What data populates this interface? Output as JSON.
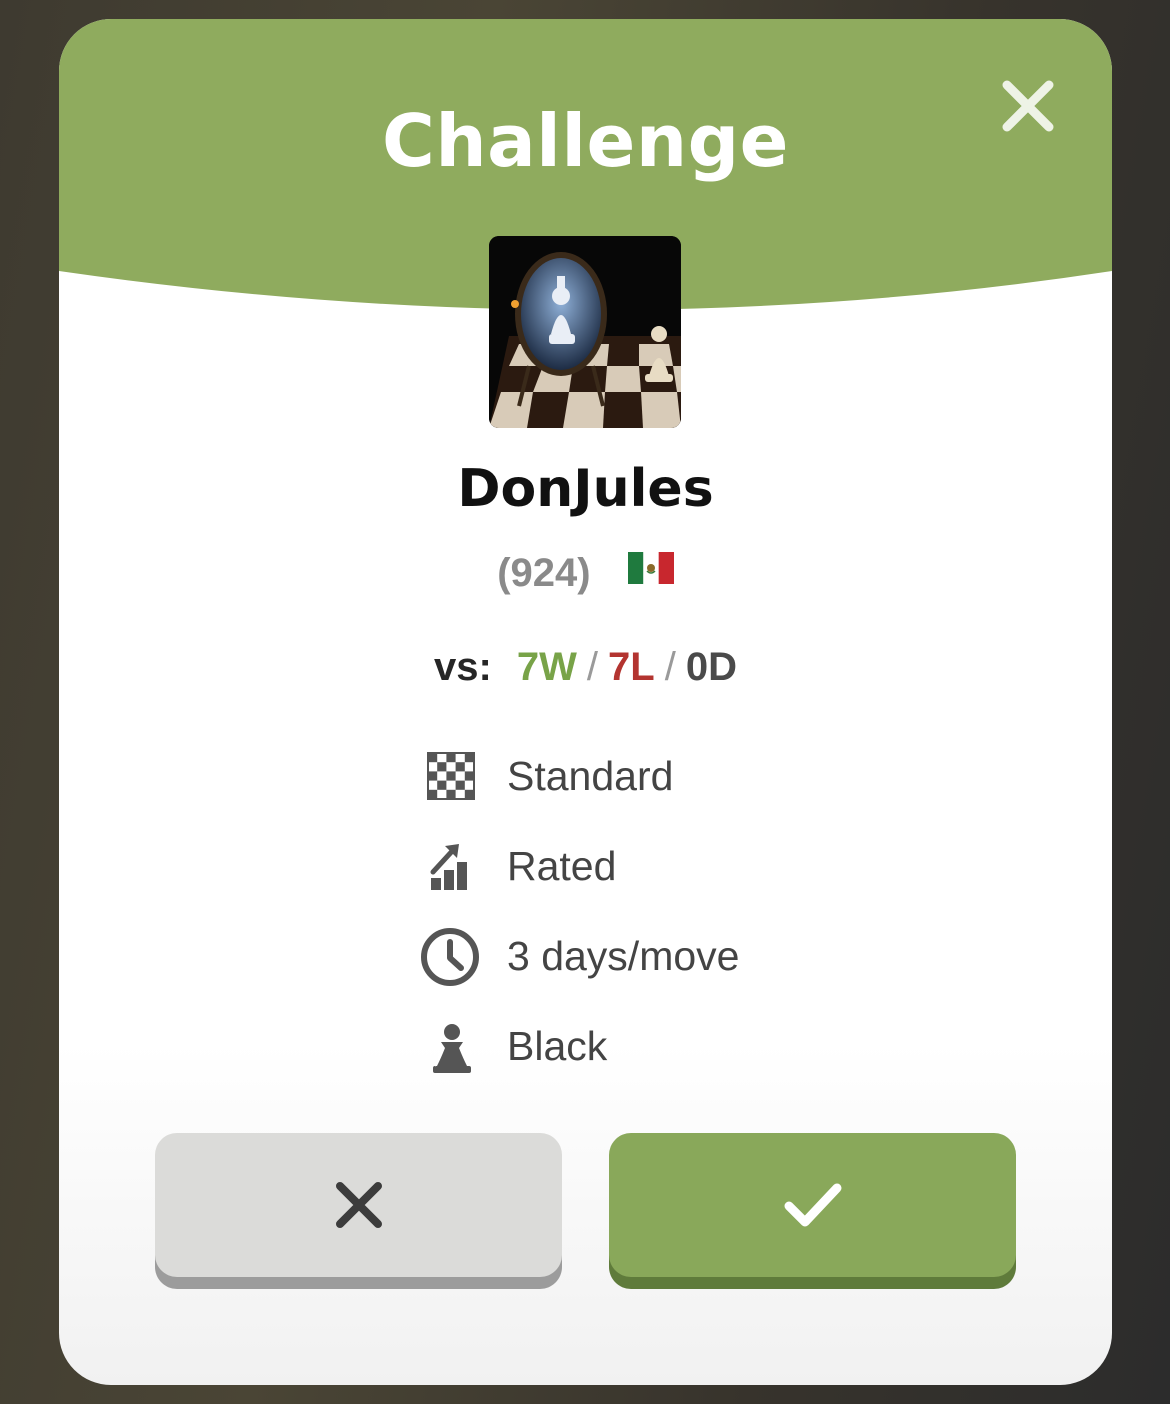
{
  "dialog": {
    "title": "Challenge",
    "close_icon": "close-icon",
    "accent_color": "#8fab5e"
  },
  "opponent": {
    "username": "DonJules",
    "rating": "(924)",
    "flag_icon": "mexico-flag-icon",
    "avatar_icon": "chess-avatar-image"
  },
  "record": {
    "prefix": "vs:",
    "wins": "7W",
    "losses": "7L",
    "draws": "0D",
    "separator": "/",
    "win_color": "#78a348",
    "loss_color": "#b33430"
  },
  "details": [
    {
      "icon": "checkerboard-icon",
      "label": "Standard"
    },
    {
      "icon": "rated-chart-icon",
      "label": "Rated"
    },
    {
      "icon": "clock-icon",
      "label": "3 days/move"
    },
    {
      "icon": "pawn-icon",
      "label": "Black"
    }
  ],
  "actions": {
    "decline_icon": "x-icon",
    "accept_icon": "checkmark-icon"
  }
}
